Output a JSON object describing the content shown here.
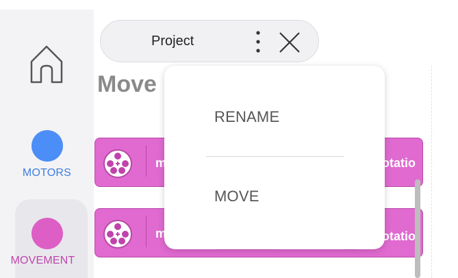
{
  "sidebar": {
    "categories": [
      {
        "label": "MOTORS",
        "color": "#4c8ef7"
      },
      {
        "label": "MOVEMENT",
        "color": "#dd5fc5",
        "selected": true
      }
    ]
  },
  "header": {
    "project_title": "Project"
  },
  "canvas": {
    "heading": "Move",
    "blocks": [
      {
        "text": "m",
        "trailing": "rotatio"
      },
      {
        "text": "m",
        "trailing": "rotatio"
      }
    ]
  },
  "menu": {
    "items": [
      {
        "label": "RENAME"
      },
      {
        "label": "MOVE"
      }
    ]
  }
}
